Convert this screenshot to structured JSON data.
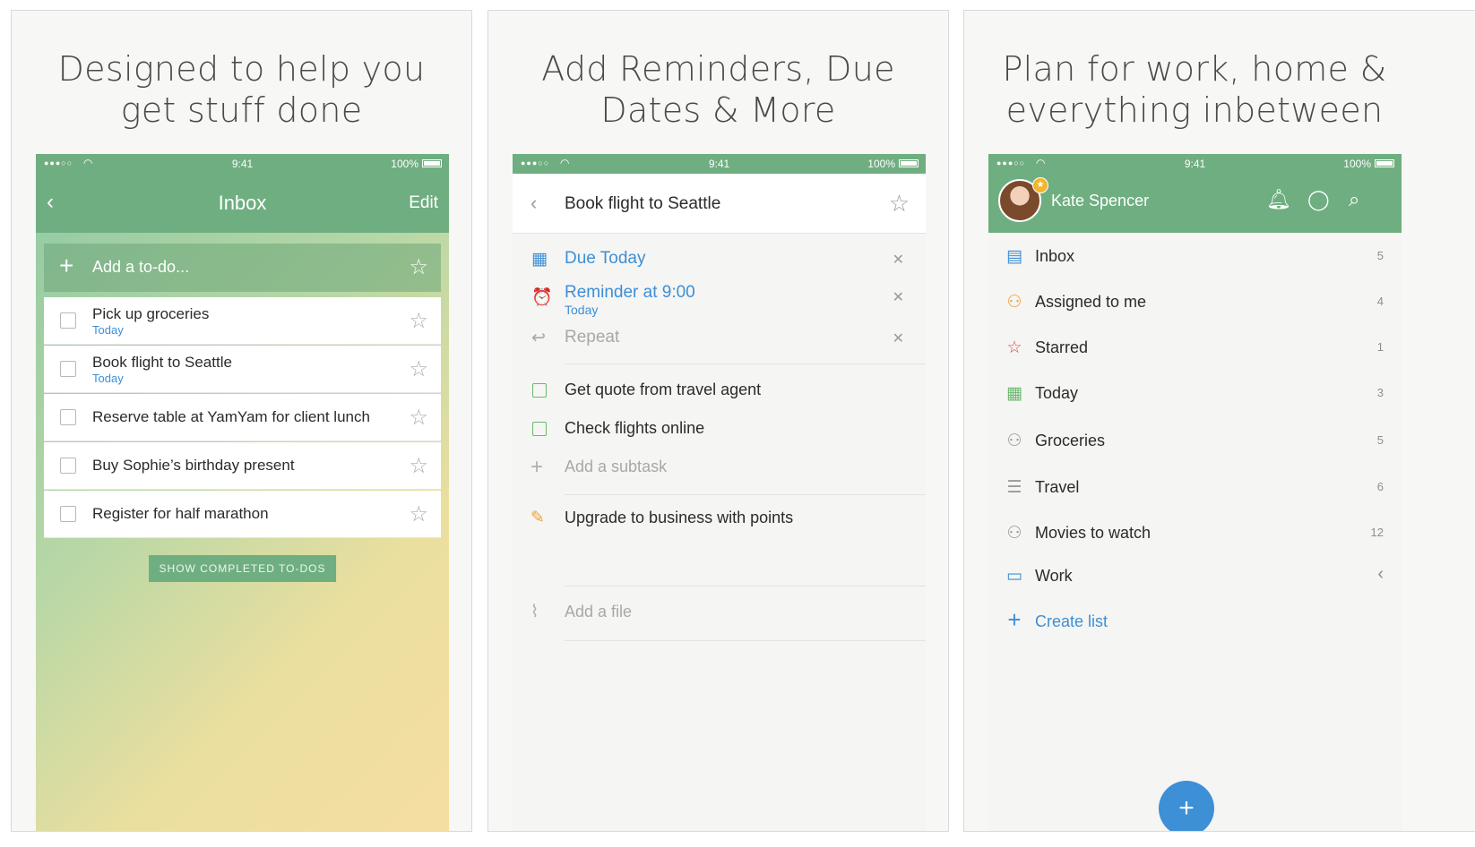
{
  "status": {
    "signal": "●●●○○",
    "time": "9:41",
    "battery": "100%"
  },
  "panel1": {
    "headline_l1": "Designed to help you",
    "headline_l2": "get stuff done",
    "nav": {
      "title": "Inbox",
      "edit": "Edit"
    },
    "add_placeholder": "Add a to-do...",
    "tasks": [
      {
        "name": "Pick up groceries",
        "due": "Today"
      },
      {
        "name": "Book flight to Seattle",
        "due": "Today"
      },
      {
        "name": "Reserve table at YamYam for client lunch"
      },
      {
        "name": "Buy Sophie’s birthday present"
      },
      {
        "name": "Register for half marathon"
      }
    ],
    "show_completed": "SHOW COMPLETED TO-DOS"
  },
  "panel2": {
    "headline_l1": "Add Reminders, Due",
    "headline_l2": "Dates & More",
    "task_title": "Book flight to Seattle",
    "due": "Due Today",
    "reminder": "Reminder at 9:00",
    "reminder_sub": "Today",
    "repeat": "Repeat",
    "subtasks": [
      "Get quote from travel agent",
      "Check flights online"
    ],
    "add_subtask": "Add a subtask",
    "note": "Upgrade to business with points",
    "add_file": "Add a file"
  },
  "panel3": {
    "headline_l1": "Plan for work, home &",
    "headline_l2": "everything inbetween",
    "user": "Kate Spencer",
    "lists": [
      {
        "name": "Inbox",
        "count": "5"
      },
      {
        "name": "Assigned to me",
        "count": "4"
      },
      {
        "name": "Starred",
        "count": "1"
      },
      {
        "name": "Today",
        "count": "3"
      },
      {
        "name": "Groceries",
        "count": "5"
      },
      {
        "name": "Travel",
        "count": "6"
      },
      {
        "name": "Movies to watch",
        "count": "12"
      },
      {
        "name": "Work",
        "count": ""
      }
    ],
    "create_list": "Create list"
  },
  "colors": {
    "brand_green": "#6fae80",
    "link_blue": "#3d8fd6",
    "star_red": "#e0483e",
    "assigned_orange": "#f0a23c",
    "folder_blue": "#3d8fd6"
  },
  "icons": [
    "back-chevron-icon",
    "star-outline-icon",
    "plus-icon",
    "checkbox-icon",
    "calendar-icon",
    "alarm-icon",
    "repeat-icon",
    "pencil-icon",
    "paperclip-icon",
    "bell-icon",
    "chat-icon",
    "search-icon",
    "inbox-icon",
    "person-icon",
    "people-icon",
    "list-icon",
    "folder-icon"
  ]
}
